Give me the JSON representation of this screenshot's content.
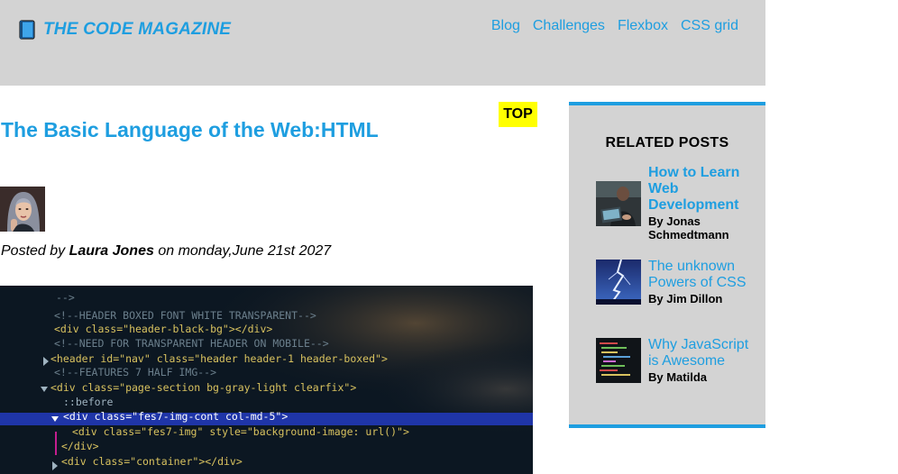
{
  "header": {
    "logo_text": "THE CODE MAGAZINE",
    "logo_icon": "book-icon",
    "nav": [
      "Blog",
      "Challenges",
      "Flexbox",
      "CSS grid"
    ]
  },
  "top_badge": "TOP",
  "post": {
    "title": "The Basic Language of the Web:HTML",
    "byline_prefix": "Posted by ",
    "author": "Laura Jones",
    "byline_suffix": " on monday,June 21st 2027"
  },
  "code": [
    "-->",
    "<!--HEADER BOXED FONT WHITE TRANSPARENT-->",
    "<div class=\"header-black-bg\"></div>",
    "<!--NEED FOR TRANSPARENT HEADER ON MOBILE-->",
    "<header id=\"nav\" class=\"header header-1 header-boxed\">",
    "<!--FEATURES 7 HALF IMG-->",
    "<div class=\"page-section bg-gray-light clearfix\">",
    "::before",
    "<div class=\"fes7-img-cont col-md-5\">",
    "<div class=\"fes7-img\" style=\"background-image: url()\">",
    "</div>",
    "<div class=\"container\"></div>"
  ],
  "sidebar": {
    "title": "RELATED POSTS",
    "posts": [
      {
        "title": "How to Learn Web Development",
        "author": "By Jonas Schmedtmann"
      },
      {
        "title": "The unknown Powers of CSS",
        "author": "By Jim Dillon"
      },
      {
        "title": "Why JavaScript is Awesome",
        "author": "By Matilda"
      }
    ]
  },
  "colors": {
    "accent": "#1e9ee0",
    "header_bg": "#d3d3d3",
    "badge_bg": "#ffff00"
  }
}
